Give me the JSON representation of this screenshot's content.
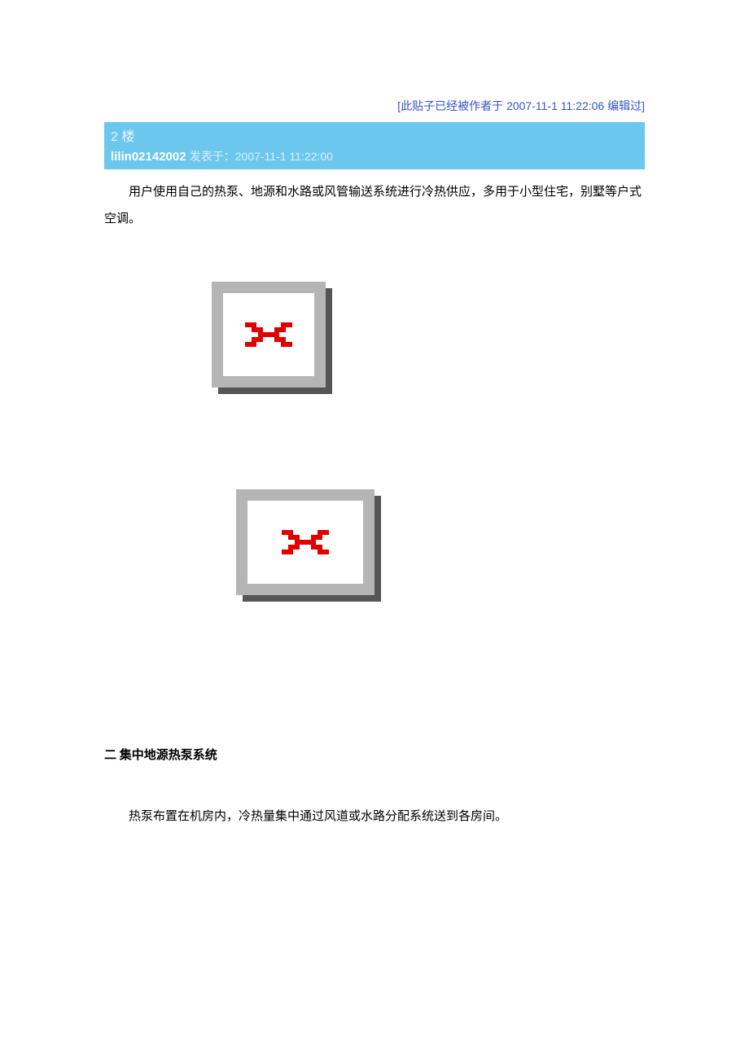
{
  "edit_notice": {
    "open": "[",
    "prefix": "此贴子已经被作者于 ",
    "timestamp": "2007-11-1 11:22:06",
    "suffix": " 编辑过",
    "close": "]"
  },
  "post": {
    "floor": "2 楼",
    "author": "lilin02142002",
    "posted_label": "发表于：",
    "posted_time": "2007-11-1 11:22:00",
    "paragraph1": "用户使用自己的热泵、地源和水路或风管输送系统进行冷热供应，多用于小型住宅，别墅等户式空调。"
  },
  "images": {
    "img1_alt": "broken-image",
    "img2_alt": "broken-image"
  },
  "section": {
    "heading": "二 集中地源热泵系统",
    "body": "热泵布置在机房内，冷热量集中通过风道或水路分配系统送到各房间。"
  }
}
